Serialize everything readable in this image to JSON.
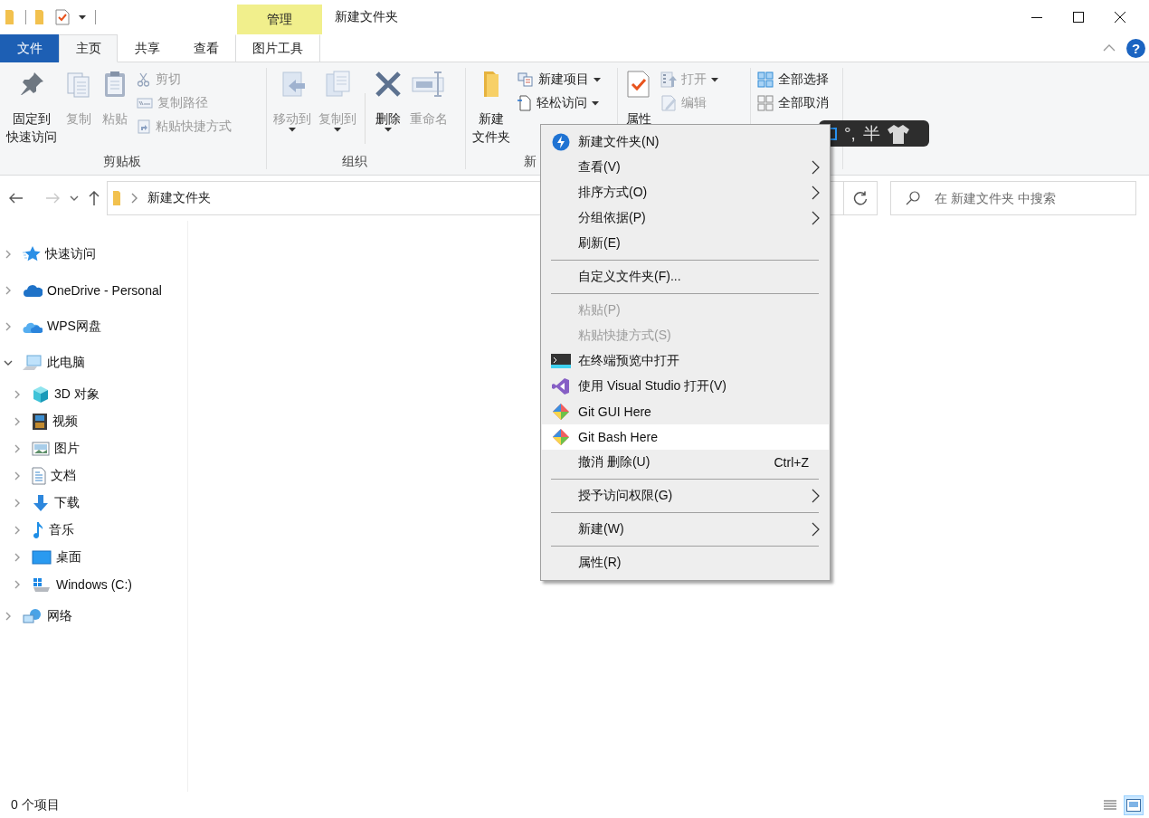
{
  "title_bar": {
    "contextual_group": "管理",
    "title": "新建文件夹"
  },
  "ribbon_tabs": [
    {
      "label": "文件",
      "kind": "file",
      "selected": false
    },
    {
      "label": "主页",
      "kind": "tab",
      "selected": true
    },
    {
      "label": "共享",
      "kind": "tab",
      "selected": false
    },
    {
      "label": "查看",
      "kind": "tab",
      "selected": false
    },
    {
      "label": "图片工具",
      "kind": "contextual",
      "selected": false
    }
  ],
  "help_button": "?",
  "ribbon_groups": [
    {
      "label": "剪贴板",
      "items": [
        {
          "kind": "large",
          "lines": [
            "固定到",
            "快速访问"
          ],
          "disabled": false
        },
        {
          "kind": "large",
          "lines": [
            "复制"
          ],
          "disabled": true
        },
        {
          "kind": "large",
          "lines": [
            "粘贴"
          ],
          "disabled": true
        },
        {
          "kind": "column",
          "buttons": [
            {
              "label": "剪切",
              "disabled": true
            },
            {
              "label": "复制路径",
              "disabled": true
            },
            {
              "label": "粘贴快捷方式",
              "disabled": true
            }
          ]
        }
      ]
    },
    {
      "label": "组织",
      "items": [
        {
          "kind": "large",
          "lines": [
            "移动到"
          ],
          "disabled": true,
          "dropdown": true
        },
        {
          "kind": "large",
          "lines": [
            "复制到"
          ],
          "disabled": true,
          "dropdown": true
        },
        {
          "kind": "divider"
        },
        {
          "kind": "large",
          "lines": [
            "删除"
          ],
          "disabled": false,
          "dropdown": true
        },
        {
          "kind": "large",
          "lines": [
            "重命名"
          ],
          "disabled": true
        }
      ]
    },
    {
      "label": "新",
      "items": [
        {
          "kind": "large",
          "lines": [
            "新建",
            "文件夹"
          ],
          "disabled": false
        },
        {
          "kind": "column",
          "buttons": [
            {
              "label": "新建项目",
              "disabled": false,
              "dropdown": true
            },
            {
              "label": "轻松访问",
              "disabled": false,
              "dropdown": true
            }
          ]
        }
      ]
    },
    {
      "items": [
        {
          "kind": "large",
          "lines": [
            "属性"
          ],
          "disabled": false
        },
        {
          "kind": "column",
          "buttons": [
            {
              "label": "打开",
              "disabled": true,
              "dropdown": true
            },
            {
              "label": "编辑",
              "disabled": true
            }
          ]
        }
      ]
    },
    {
      "items": [
        {
          "kind": "column",
          "buttons": [
            {
              "label": "全部选择",
              "disabled": false
            },
            {
              "label": "全部取消",
              "disabled": false
            }
          ]
        }
      ]
    }
  ],
  "navigation": {
    "back_disabled": false,
    "forward_disabled": true
  },
  "address_bar": {
    "path": "新建文件夹",
    "search_placeholder": "在 新建文件夹 中搜索"
  },
  "nav_tree": [
    {
      "label": "快速访问",
      "expanded": false
    },
    {
      "label": "OneDrive - Personal",
      "expanded": false
    },
    {
      "label": "WPS网盘",
      "expanded": false
    },
    {
      "label": "此电脑",
      "expanded": true,
      "children": [
        {
          "label": "3D 对象",
          "expanded": false
        },
        {
          "label": "视频",
          "expanded": false
        },
        {
          "label": "图片",
          "expanded": false
        },
        {
          "label": "文档",
          "expanded": false
        },
        {
          "label": "下载",
          "expanded": false
        },
        {
          "label": "音乐",
          "expanded": false
        },
        {
          "label": "桌面",
          "expanded": false
        },
        {
          "label": "Windows (C:)",
          "expanded": false
        }
      ]
    },
    {
      "label": "网络",
      "expanded": false
    }
  ],
  "status_bar": {
    "item_count": "0 个项目",
    "views": [
      {
        "selected": false
      },
      {
        "selected": true
      }
    ]
  },
  "context_menu": [
    {
      "kind": "item",
      "label": "新建文件夹(N)",
      "selected": false,
      "disabled": false
    },
    {
      "kind": "item",
      "label": "查看(V)",
      "selected": false,
      "disabled": false,
      "submenu": true
    },
    {
      "kind": "item",
      "label": "排序方式(O)",
      "selected": false,
      "disabled": false,
      "submenu": true
    },
    {
      "kind": "item",
      "label": "分组依据(P)",
      "selected": false,
      "disabled": false,
      "submenu": true
    },
    {
      "kind": "item",
      "label": "刷新(E)",
      "selected": false,
      "disabled": false
    },
    {
      "kind": "separator"
    },
    {
      "kind": "item",
      "label": "自定义文件夹(F)...",
      "selected": false,
      "disabled": false
    },
    {
      "kind": "separator"
    },
    {
      "kind": "item",
      "label": "粘贴(P)",
      "selected": false,
      "disabled": true
    },
    {
      "kind": "item",
      "label": "粘贴快捷方式(S)",
      "selected": false,
      "disabled": true
    },
    {
      "kind": "item",
      "label": "在终端预览中打开",
      "selected": false,
      "disabled": false
    },
    {
      "kind": "item",
      "label": "使用 Visual Studio 打开(V)",
      "selected": false,
      "disabled": false
    },
    {
      "kind": "item",
      "label": "Git GUI Here",
      "selected": false,
      "disabled": false
    },
    {
      "kind": "item",
      "label": "Git Bash Here",
      "selected": true,
      "disabled": false
    },
    {
      "kind": "item",
      "label": "撤消 删除(U)",
      "selected": false,
      "disabled": false,
      "shortcut": "Ctrl+Z"
    },
    {
      "kind": "separator"
    },
    {
      "kind": "item",
      "label": "授予访问权限(G)",
      "selected": false,
      "disabled": false,
      "submenu": true
    },
    {
      "kind": "separator"
    },
    {
      "kind": "item",
      "label": "新建(W)",
      "selected": false,
      "disabled": false,
      "submenu": true
    },
    {
      "kind": "separator"
    },
    {
      "kind": "item",
      "label": "属性(R)",
      "selected": false,
      "disabled": false
    }
  ],
  "ime_bar": {
    "punctuation": "°,",
    "width_mode": "半"
  }
}
